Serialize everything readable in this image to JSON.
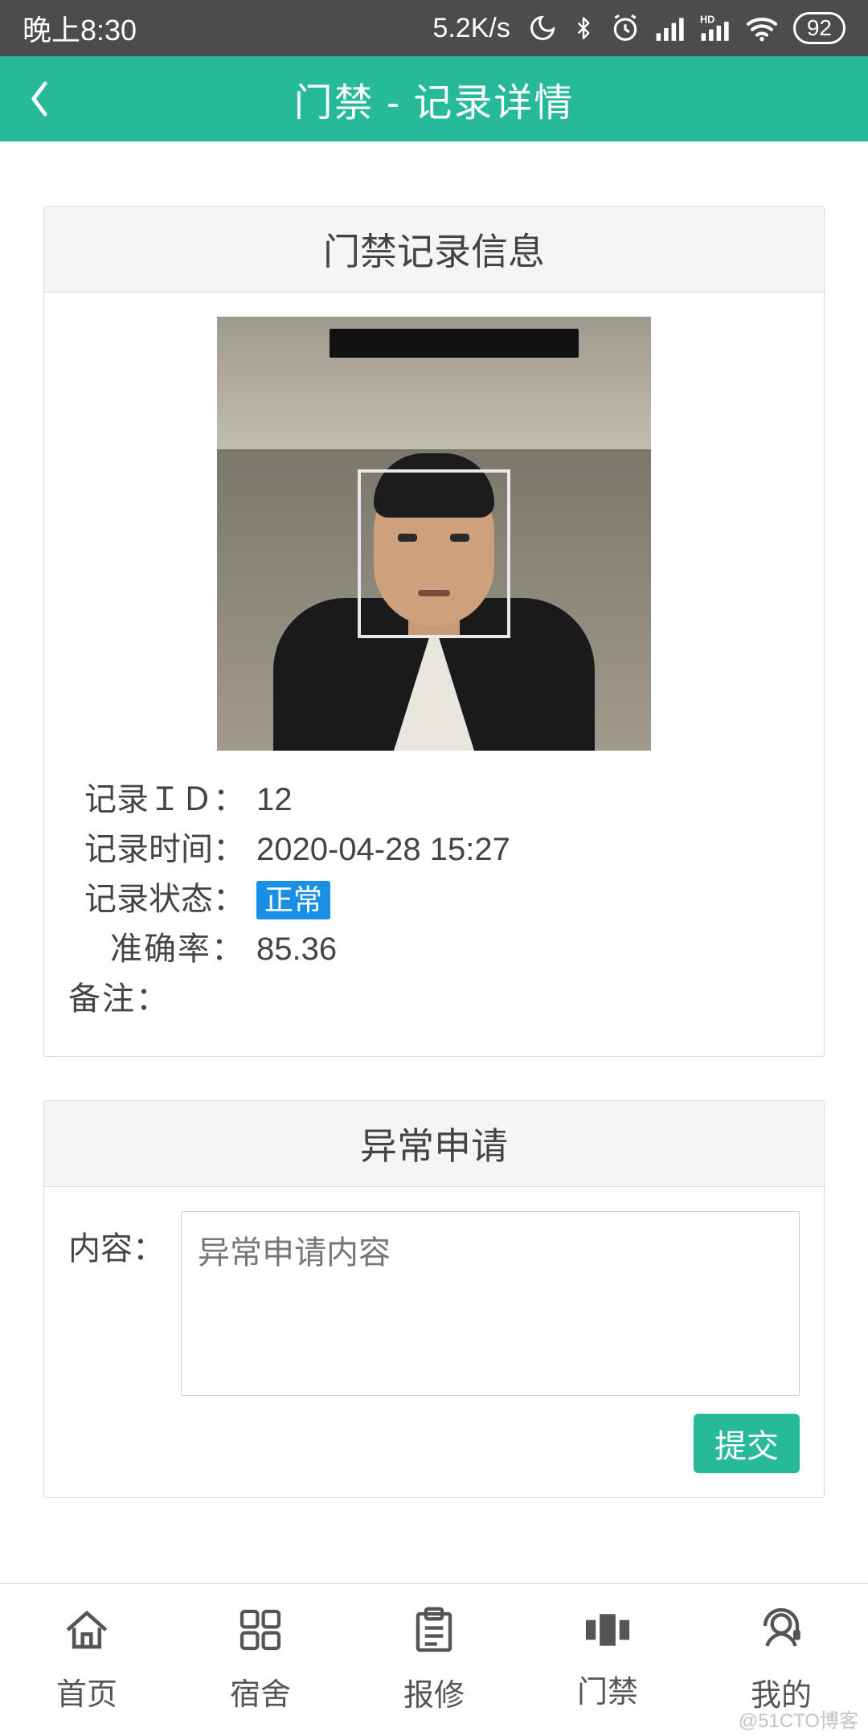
{
  "status": {
    "time": "晚上8:30",
    "net_speed": "5.2K/s",
    "battery": "92"
  },
  "header": {
    "title": "门禁 - 记录详情"
  },
  "record_panel": {
    "title": "门禁记录信息",
    "rows": {
      "id_label": "记录ＩＤ：",
      "id_value": "12",
      "time_label": "记录时间：",
      "time_value": "2020-04-28 15:27",
      "status_label": "记录状态：",
      "status_value": "正常",
      "acc_label": "准确率：",
      "acc_value": "85.36",
      "note_label": "备注：",
      "note_value": ""
    }
  },
  "anomaly_panel": {
    "title": "异常申请",
    "content_label": "内容：",
    "placeholder": "异常申请内容",
    "submit_label": "提交"
  },
  "nav": {
    "home": "首页",
    "dorm": "宿舍",
    "repair": "报修",
    "gate": "门禁",
    "mine": "我的"
  },
  "watermark": "@51CTO博客"
}
